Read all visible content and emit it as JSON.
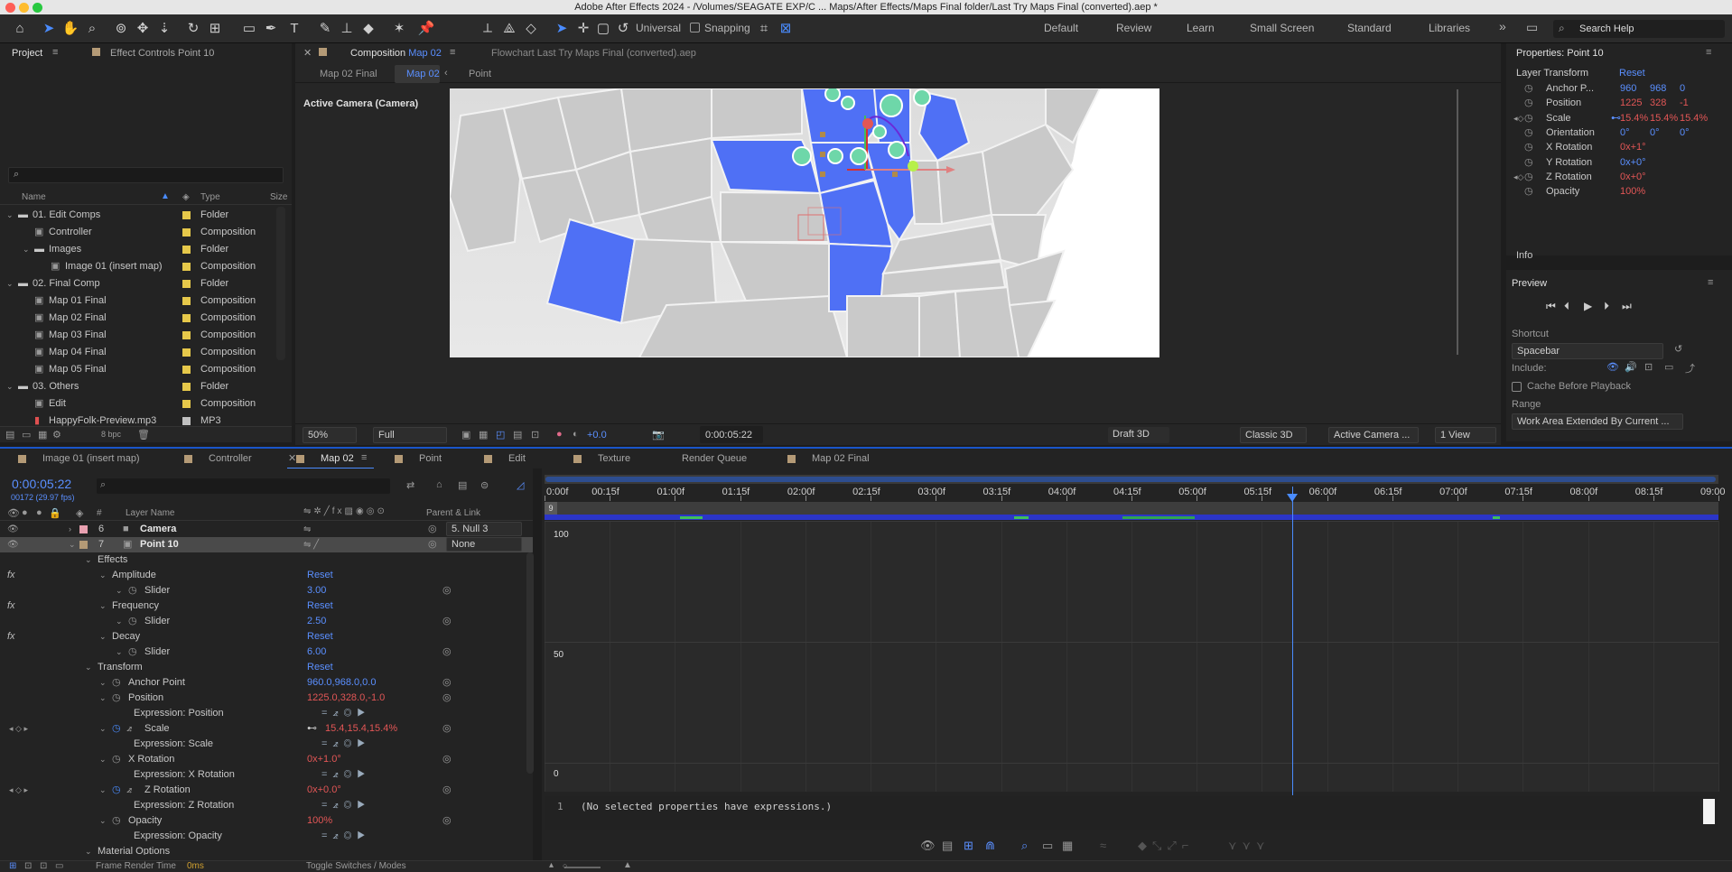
{
  "title_bar": {
    "title": "Adobe After Effects 2024 - /Volumes/SEAGATE EXP/C ... Maps/After Effects/Maps Final folder/Last Try Maps Final (converted).aep *"
  },
  "toolbar": {
    "tools": [
      "home-icon",
      "selection-tool-icon",
      "hand-tool-icon",
      "zoom-tool-icon",
      "orbit-camera-icon",
      "track-xy-camera-icon",
      "dolly-camera-icon",
      "rotate-tool-icon",
      "pan-behind-icon",
      "rectangle-tool-icon",
      "pen-tool-icon",
      "type-tool-icon",
      "brush-tool-icon",
      "clone-stamp-icon",
      "eraser-tool-icon",
      "roto-brush-icon",
      "puppet-pin-icon"
    ],
    "universal_label": "Universal",
    "snapping_label": "Snapping",
    "workspaces": [
      "Default",
      "Review",
      "Learn",
      "Small Screen",
      "Standard",
      "Libraries"
    ],
    "more": "»",
    "search_placeholder": "Search Help"
  },
  "project_panel": {
    "tab_project": "Project",
    "tab_effect_controls": "Effect Controls Point 10",
    "search_placeholder": "",
    "columns": {
      "name": "Name",
      "type": "Type",
      "size": "Size"
    },
    "items": [
      {
        "name": "01. Edit Comps",
        "type": "Folder",
        "kind": "folder",
        "open": true,
        "indent": 0
      },
      {
        "name": "Controller",
        "type": "Composition",
        "kind": "comp",
        "indent": 1
      },
      {
        "name": "Images",
        "type": "Folder",
        "kind": "folder",
        "open": true,
        "indent": 1
      },
      {
        "name": "Image 01 (insert map)",
        "type": "Composition",
        "kind": "comp",
        "indent": 2
      },
      {
        "name": "02. Final Comp",
        "type": "Folder",
        "kind": "folder",
        "open": true,
        "indent": 0
      },
      {
        "name": "Map 01 Final",
        "type": "Composition",
        "kind": "comp",
        "indent": 1
      },
      {
        "name": "Map 02 Final",
        "type": "Composition",
        "kind": "comp",
        "indent": 1
      },
      {
        "name": "Map 03 Final",
        "type": "Composition",
        "kind": "comp",
        "indent": 1
      },
      {
        "name": "Map 04 Final",
        "type": "Composition",
        "kind": "comp",
        "indent": 1
      },
      {
        "name": "Map 05 Final",
        "type": "Composition",
        "kind": "comp",
        "indent": 1
      },
      {
        "name": "03. Others",
        "type": "Folder",
        "kind": "folder",
        "open": true,
        "indent": 0
      },
      {
        "name": "Edit",
        "type": "Composition",
        "kind": "comp",
        "indent": 1
      },
      {
        "name": "HappyFolk-Preview.mp3",
        "type": "MP3",
        "kind": "audio",
        "indent": 1
      }
    ],
    "bpc": "8 bpc"
  },
  "composition": {
    "tab_prefix": "Composition",
    "tab_name": "Map 02",
    "flowchart_label": "Flowchart Last Try Maps Final (converted).aep",
    "breadcrumbs": [
      "Map 02 Final",
      "Map 02",
      "Point"
    ],
    "camera_label": "Active Camera (Camera)",
    "zoom": "50%",
    "resolution": "Full",
    "exposure": "+0.0",
    "timecode": "0:00:05:22",
    "renderer": "Draft 3D",
    "renderer_mode": "Classic 3D",
    "view": "Active Camera ...",
    "views": "1 View"
  },
  "properties": {
    "title": "Properties: Point 10",
    "layer_transform": "Layer Transform",
    "reset": "Reset",
    "rows": [
      {
        "label": "Anchor P...",
        "values": [
          "960",
          "968",
          "0"
        ],
        "color": "blue"
      },
      {
        "label": "Position",
        "values": [
          "1225",
          "328",
          "-1"
        ],
        "color": "red"
      },
      {
        "label": "Scale",
        "values": [
          "15.4%",
          "15.4%",
          "15.4%"
        ],
        "color": "red"
      },
      {
        "label": "Orientation",
        "values": [
          "0°",
          "0°",
          "0°"
        ],
        "color": "blue"
      },
      {
        "label": "X Rotation",
        "values": [
          "0x+1°"
        ],
        "color": "red"
      },
      {
        "label": "Y Rotation",
        "values": [
          "0x+0°"
        ],
        "color": "blue"
      },
      {
        "label": "Z Rotation",
        "values": [
          "0x+0°"
        ],
        "color": "red"
      },
      {
        "label": "Opacity",
        "values": [
          "100%"
        ],
        "color": "red"
      }
    ],
    "info": "Info"
  },
  "preview": {
    "title": "Preview",
    "shortcut_label": "Shortcut",
    "shortcut": "Spacebar",
    "include_label": "Include:",
    "cache_label": "Cache Before Playback",
    "range_label": "Range",
    "range": "Work Area Extended By Current ..."
  },
  "timeline": {
    "tabs": [
      "Image 01 (insert map)",
      "Controller",
      "Map 02",
      "Point",
      "Edit",
      "Texture",
      "Render Queue",
      "Map 02 Final"
    ],
    "current_time": "0:00:05:22",
    "frame_info": "00172 (29.97 fps)",
    "columns": {
      "num": "#",
      "layer_name": "Layer Name",
      "parent": "Parent & Link"
    },
    "layers": [
      {
        "num": "6",
        "name": "Camera",
        "parent": "5. Null 3"
      },
      {
        "num": "7",
        "name": "Point 10",
        "parent": "None"
      }
    ],
    "props": [
      {
        "label": "Effects",
        "indent": 1
      },
      {
        "label": "Amplitude",
        "indent": 2,
        "reset": "Reset",
        "fx": true
      },
      {
        "label": "Slider",
        "indent": 3,
        "value": "3.00",
        "vc": "blue"
      },
      {
        "label": "Frequency",
        "indent": 2,
        "reset": "Reset",
        "fx": true
      },
      {
        "label": "Slider",
        "indent": 3,
        "value": "2.50",
        "vc": "blue"
      },
      {
        "label": "Decay",
        "indent": 2,
        "reset": "Reset",
        "fx": true
      },
      {
        "label": "Slider",
        "indent": 3,
        "value": "6.00",
        "vc": "blue"
      },
      {
        "label": "Transform",
        "indent": 1,
        "reset": "Reset"
      },
      {
        "label": "Anchor Point",
        "indent": 2,
        "value": "960.0,968.0,0.0",
        "vc": "blue"
      },
      {
        "label": "Position",
        "indent": 2,
        "value": "1225.0,328.0,-1.0",
        "vc": "red"
      },
      {
        "label": "Expression: Position",
        "indent": 3,
        "expr": true
      },
      {
        "label": "Scale",
        "indent": 2,
        "value": "15.4,15.4,15.4%",
        "vc": "red",
        "kf": true
      },
      {
        "label": "Expression: Scale",
        "indent": 3,
        "expr": true
      },
      {
        "label": "X Rotation",
        "indent": 2,
        "value": "0x+1.0°",
        "vc": "red"
      },
      {
        "label": "Expression: X Rotation",
        "indent": 3,
        "expr": true
      },
      {
        "label": "Z Rotation",
        "indent": 2,
        "value": "0x+0.0°",
        "vc": "red",
        "kf": true
      },
      {
        "label": "Expression: Z Rotation",
        "indent": 3,
        "expr": true
      },
      {
        "label": "Opacity",
        "indent": 2,
        "value": "100%",
        "vc": "red"
      },
      {
        "label": "Expression: Opacity",
        "indent": 3,
        "expr": true
      },
      {
        "label": "Material Options",
        "indent": 1
      }
    ],
    "ruler": [
      "0:00f",
      "00:15f",
      "01:00f",
      "01:15f",
      "02:00f",
      "02:15f",
      "03:00f",
      "03:15f",
      "04:00f",
      "04:15f",
      "05:00f",
      "05:15f",
      "06:00f",
      "06:15f",
      "07:00f",
      "07:15f",
      "08:00f",
      "08:15f",
      "09:00"
    ],
    "graph_labels": [
      "100",
      "50",
      "0"
    ],
    "expression_line": "1",
    "expression_text": "(No selected properties have expressions.)",
    "footer_render_label": "Frame Render Time",
    "footer_render_value": "0ms",
    "footer_toggle": "Toggle Switches / Modes"
  },
  "colors": {
    "accent": "#4a8cff",
    "state_highlight": "#4f70f5",
    "pin": "#6ed7a9",
    "label_yellow": "#e6c84a",
    "value_red": "#e25656",
    "value_blue": "#5a8fff"
  }
}
